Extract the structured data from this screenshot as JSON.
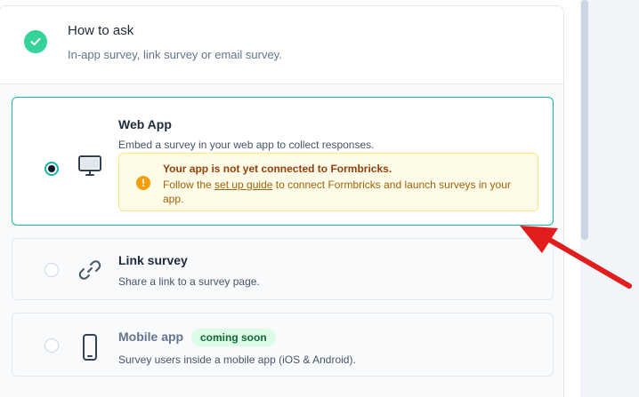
{
  "header": {
    "title": "How to ask",
    "subtitle": "In-app survey, link survey or email survey."
  },
  "options": {
    "web": {
      "title": "Web App",
      "description": "Embed a survey in your web app to collect responses.",
      "selected": true,
      "icon": "monitor-icon",
      "warning": {
        "title": "Your app is not yet connected to Formbricks.",
        "before_link": "Follow the ",
        "link": "set up guide",
        "after_link": " to connect Formbricks and launch surveys in your app."
      }
    },
    "link": {
      "title": "Link survey",
      "description": "Share a link to a survey page.",
      "selected": false,
      "icon": "link-icon"
    },
    "mobile": {
      "title": "Mobile app",
      "badge": "coming soon",
      "description": "Survey users inside a mobile app (iOS & Android).",
      "selected": false,
      "icon": "smartphone-icon"
    }
  },
  "colors": {
    "accent": "#14b8a6",
    "success": "#34d399",
    "warning_bg": "#fefce8",
    "warning_text": "#92400e",
    "annotation_arrow": "#e11d1d"
  }
}
